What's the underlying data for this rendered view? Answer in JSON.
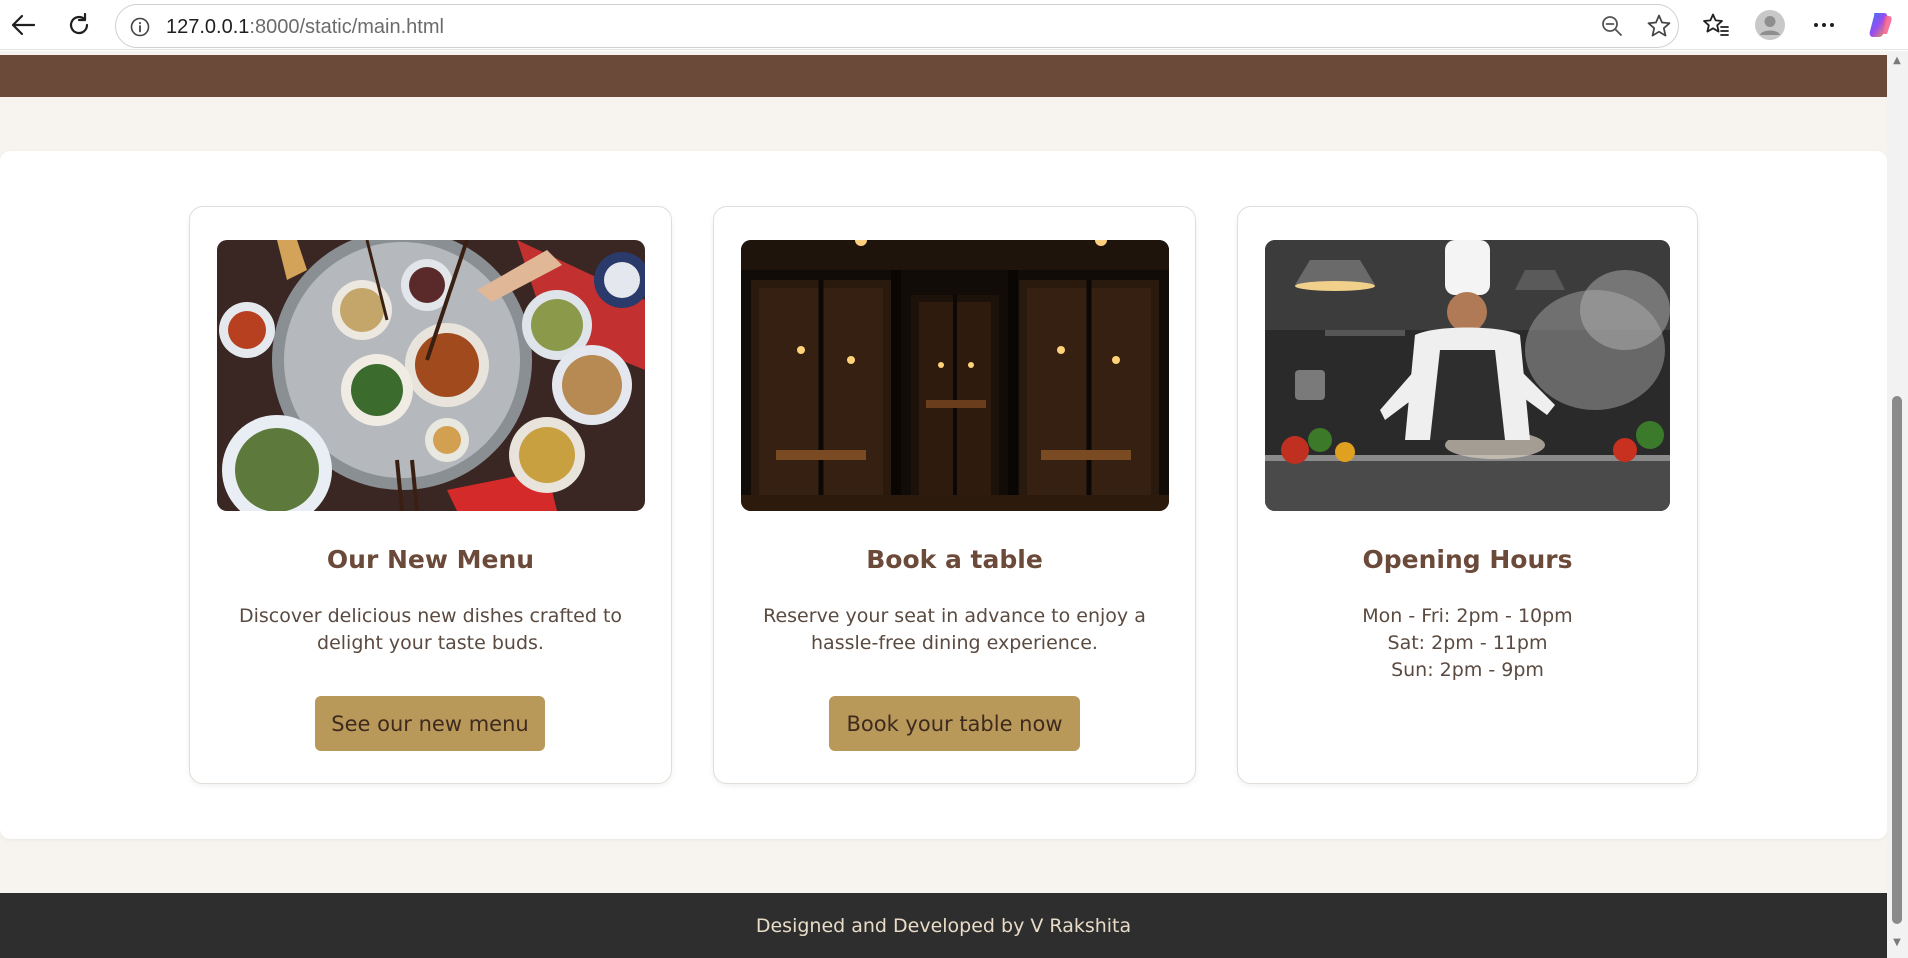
{
  "browser": {
    "url_host": "127.0.0.1",
    "url_rest": ":8000/static/main.html",
    "icons": [
      "back-icon",
      "refresh-icon",
      "info-icon",
      "zoom-out-icon",
      "star-icon",
      "favorites-icon",
      "profile-icon",
      "more-icon",
      "copilot-icon"
    ]
  },
  "cards": [
    {
      "title": "Our New Menu",
      "text": "Discover delicious new dishes crafted to delight your taste buds.",
      "button": "See our new menu",
      "image": "food-table-photo"
    },
    {
      "title": "Book a table",
      "text": "Reserve your seat in advance to enjoy a hassle-free dining experience.",
      "button": "Book your table now",
      "image": "restaurant-interior-photo"
    },
    {
      "title": "Opening Hours",
      "lines": [
        "Mon - Fri: 2pm - 10pm",
        "Sat: 2pm - 11pm",
        "Sun: 2pm - 9pm"
      ],
      "image": "chef-cooking-photo"
    }
  ],
  "footer": {
    "text": "Designed and Developed by V Rakshita"
  },
  "colors": {
    "header": "#6b4a3a",
    "button": "#b8995a",
    "title": "#6b4a3a",
    "footer": "#2e2e2e",
    "page_bg": "#f7f3ee"
  }
}
